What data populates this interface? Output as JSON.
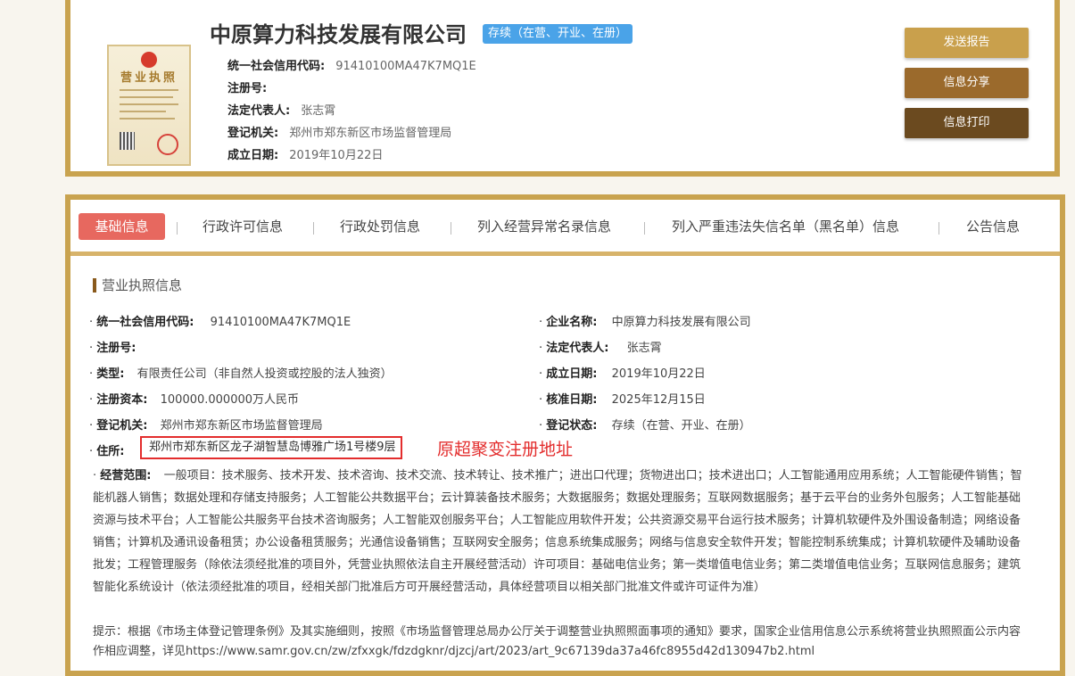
{
  "company": {
    "name": "中原算力科技发展有限公司",
    "status": "存续（在营、开业、在册）",
    "credit_code_label": "统一社会信用代码:",
    "credit_code": "91410100MA47K7MQ1E",
    "reg_no_label": "注册号:",
    "reg_no": "",
    "legal_rep_label": "法定代表人:",
    "legal_rep": "张志霄",
    "authority_label": "登记机关:",
    "authority": "郑州市郑东新区市场监督管理局",
    "founded_label": "成立日期:",
    "founded": "2019年10月22日"
  },
  "actions": {
    "send_report": "发送报告",
    "share": "信息分享",
    "print": "信息打印"
  },
  "colors": {
    "border_gold": "#c9a34f",
    "btn_send": "#c9a04c",
    "btn_share": "#9b6a2c",
    "btn_print": "#6b4a1f",
    "active_tab": "#e7685f",
    "status_badge": "#4aa3e8",
    "highlight_red": "#e32d2d"
  },
  "tabs": [
    {
      "label": "基础信息",
      "active": true
    },
    {
      "label": "行政许可信息"
    },
    {
      "label": "行政处罚信息"
    },
    {
      "label": "列入经营异常名录信息"
    },
    {
      "label": "列入严重违法失信名单（黑名单）信息"
    },
    {
      "label": "公告信息"
    }
  ],
  "section": {
    "title": "营业执照信息",
    "bullet": "·"
  },
  "fields": {
    "credit_code": {
      "label": "统一社会信用代码:",
      "value": "91410100MA47K7MQ1E"
    },
    "company_name": {
      "label": "企业名称:",
      "value": "中原算力科技发展有限公司"
    },
    "reg_no": {
      "label": "注册号:",
      "value": ""
    },
    "legal_rep": {
      "label": "法定代表人:",
      "value": "张志霄"
    },
    "type": {
      "label": "类型:",
      "value": "有限责任公司（非自然人投资或控股的法人独资）"
    },
    "founded": {
      "label": "成立日期:",
      "value": "2019年10月22日"
    },
    "capital": {
      "label": "注册资本:",
      "value": "100000.000000万人民币"
    },
    "approved": {
      "label": "核准日期:",
      "value": "2025年12月15日"
    },
    "authority": {
      "label": "登记机关:",
      "value": "郑州市郑东新区市场监督管理局"
    },
    "reg_status": {
      "label": "登记状态:",
      "value": "存续（在营、开业、在册）"
    },
    "address": {
      "label": "住所:",
      "value": "郑州市郑东新区龙子湖智慧岛博雅广场1号楼9层"
    }
  },
  "annotation": "原超聚变注册地址",
  "scope": {
    "label": "经营范围:",
    "text": "一般项目：技术服务、技术开发、技术咨询、技术交流、技术转让、技术推广；进出口代理；货物进出口；技术进出口；人工智能通用应用系统；人工智能硬件销售；智能机器人销售；数据处理和存储支持服务；人工智能公共数据平台；云计算装备技术服务；大数据服务；数据处理服务；互联网数据服务；基于云平台的业务外包服务；人工智能基础资源与技术平台；人工智能公共服务平台技术咨询服务；人工智能双创服务平台；人工智能应用软件开发；公共资源交易平台运行技术服务；计算机软硬件及外围设备制造；网络设备销售；计算机及通讯设备租赁；办公设备租赁服务；光通信设备销售；互联网安全服务；信息系统集成服务；网络与信息安全软件开发；智能控制系统集成；计算机软硬件及辅助设备批发；工程管理服务（除依法须经批准的项目外，凭营业执照依法自主开展经营活动）许可项目：基础电信业务；第一类增值电信业务；第二类增值电信业务；互联网信息服务；建筑智能化系统设计（依法须经批准的项目，经相关部门批准后方可开展经营活动，具体经营项目以相关部门批准文件或许可证件为准）"
  },
  "tip": "提示：根据《市场主体登记管理条例》及其实施细则，按照《市场监督管理总局办公厅关于调整营业执照照面事项的通知》要求，国家企业信用信息公示系统将营业执照照面公示内容作相应调整，详见https://www.samr.gov.cn/zw/zfxxgk/fdzdgknr/djzcj/art/2023/art_9c67139da37a46fc8955d42d130947b2.html",
  "license_image": {
    "title": "营业执照"
  }
}
